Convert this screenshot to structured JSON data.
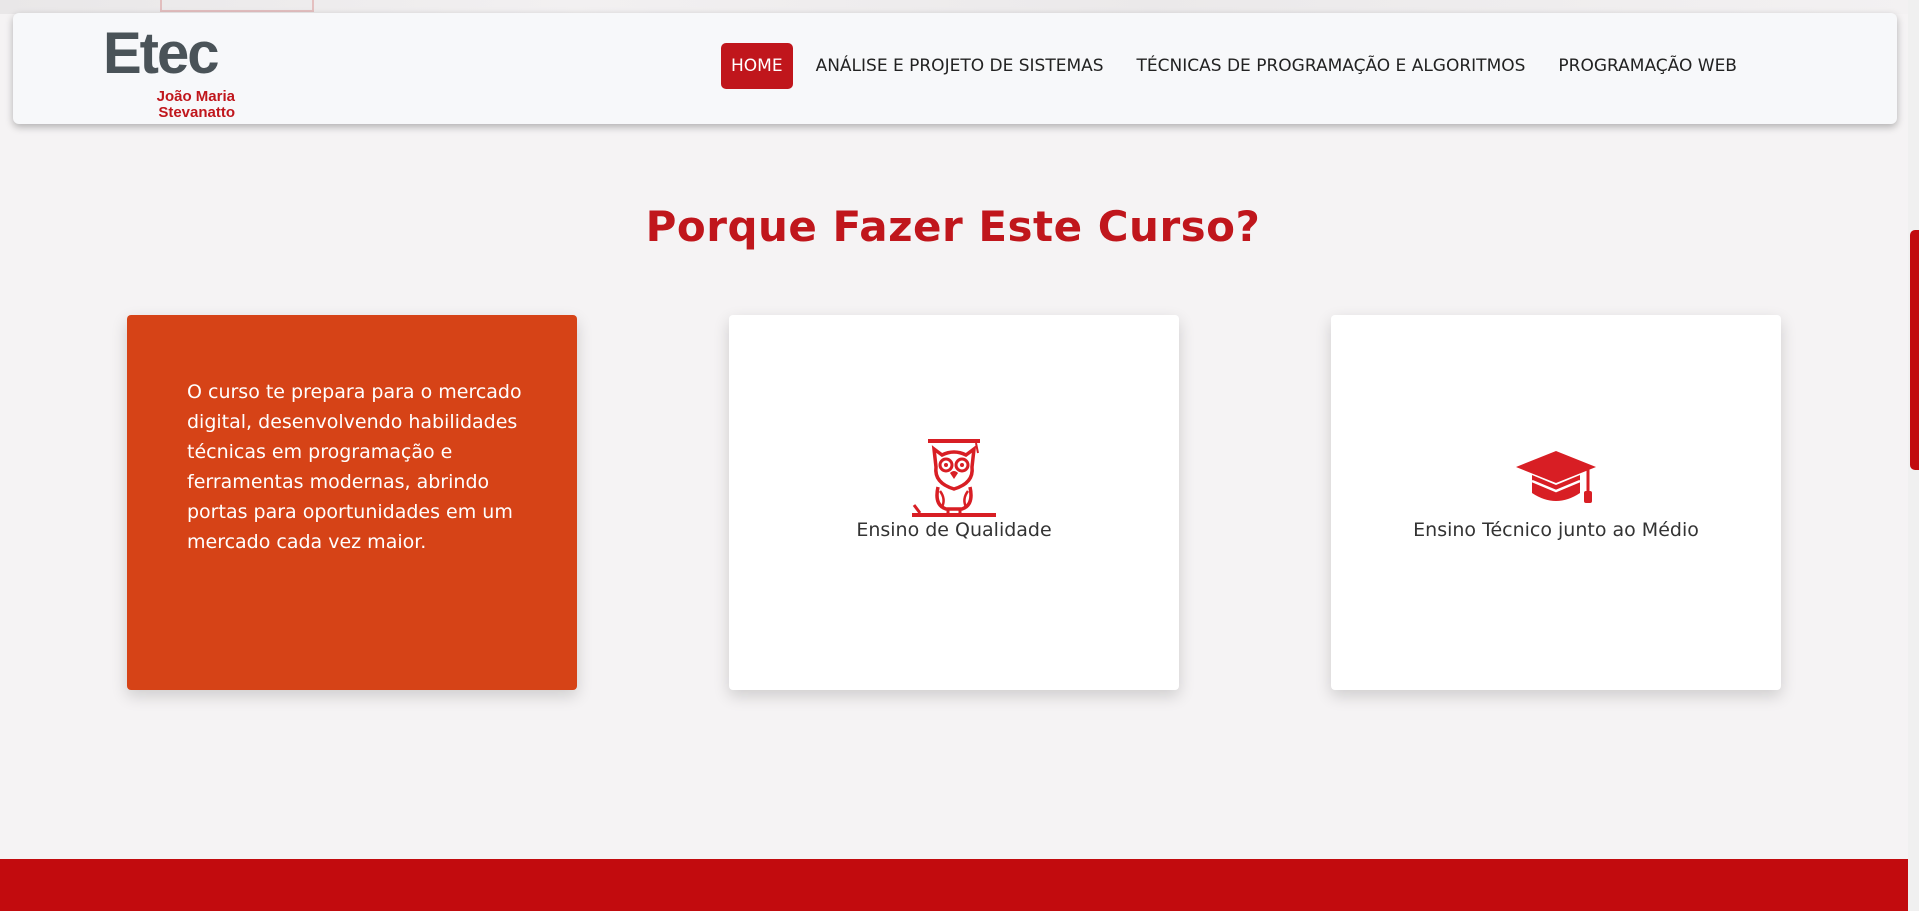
{
  "logo": {
    "main": "Etec",
    "sub_line1": "João Maria",
    "sub_line2": "Stevanatto"
  },
  "nav": {
    "items": [
      {
        "label": "HOME",
        "active": true
      },
      {
        "label": "ANÁLISE E PROJETO DE SISTEMAS",
        "active": false
      },
      {
        "label": "TÉCNICAS DE PROGRAMAÇÃO E ALGORITMOS",
        "active": false
      },
      {
        "label": "PROGRAMAÇÃO WEB",
        "active": false
      }
    ]
  },
  "section": {
    "title": "Porque Fazer Este Curso?",
    "cards": [
      {
        "text": "O curso te prepara para o mercado digital, desenvolvendo habilidades técnicas em programação e ferramentas modernas, abrindo portas para oportunidades em um mercado cada vez maior."
      },
      {
        "icon": "owl-graduation-icon",
        "label": "Ensino de Qualidade"
      },
      {
        "icon": "graduation-cap-icon",
        "label": "Ensino Técnico junto ao Médio"
      }
    ]
  },
  "colors": {
    "brand_red": "#c0161c",
    "card_orange": "#d64317",
    "footer_red": "#c20b0e"
  }
}
